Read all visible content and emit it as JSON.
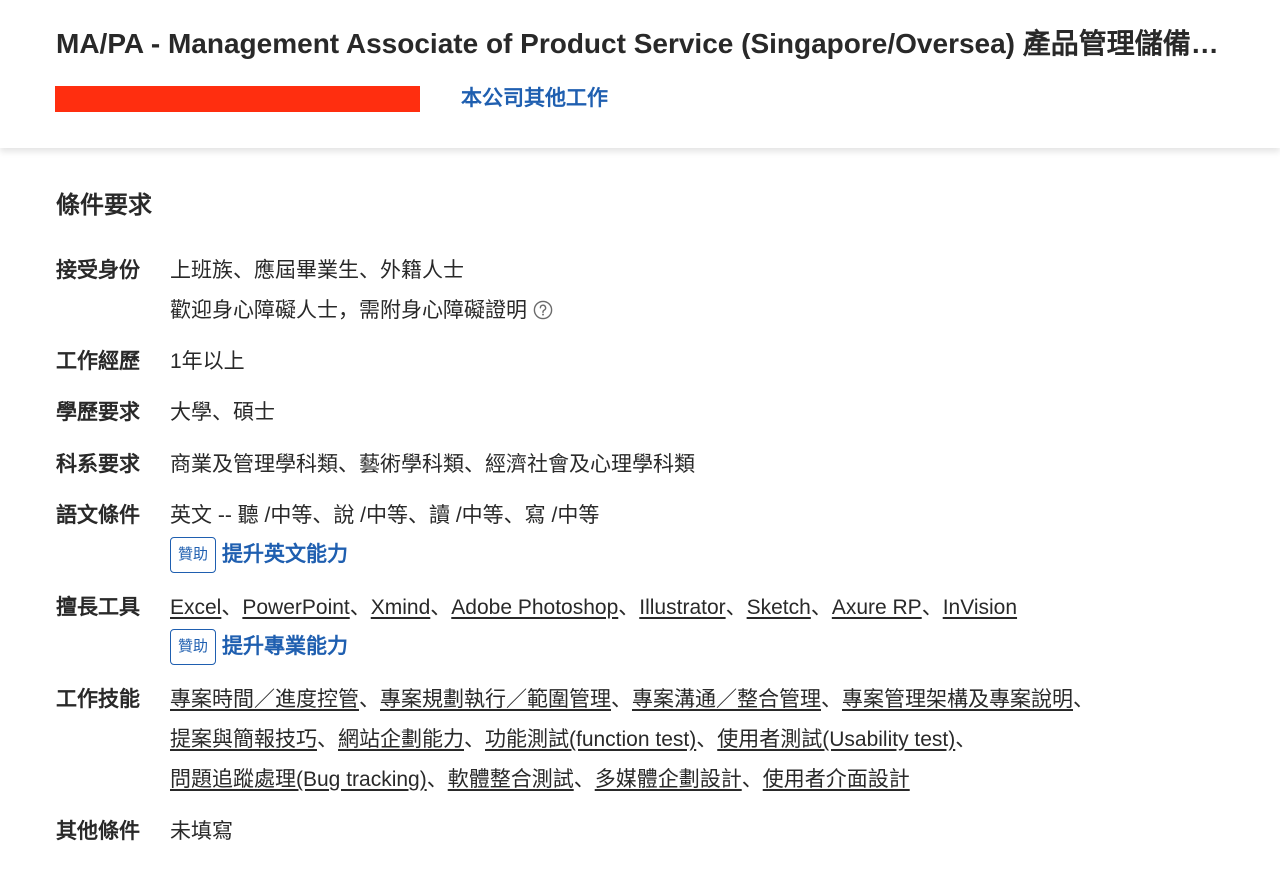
{
  "header": {
    "job_title": "MA/PA - Management Associate of Product Service (Singapore/Oversea) 產品管理儲備幹部",
    "redaction_color": "#ff2e0f",
    "company_jobs_link": "本公司其他工作"
  },
  "requirements": {
    "section_title": "條件要求",
    "identity": {
      "label": "接受身份",
      "value": "上班族、應屆畢業生、外籍人士",
      "note": "歡迎身心障礙人士，需附身心障礙證明"
    },
    "experience": {
      "label": "工作經歷",
      "value": "1年以上"
    },
    "education": {
      "label": "學歷要求",
      "value": "大學、碩士"
    },
    "major": {
      "label": "科系要求",
      "value": "商業及管理學科類、藝術學科類、經濟社會及心理學科類"
    },
    "language": {
      "label": "語文條件",
      "value": "英文 -- 聽 /中等、說 /中等、讀 /中等、寫 /中等",
      "sponsor_badge": "贊助",
      "promo_link": "提升英文能力"
    },
    "tools": {
      "label": "擅長工具",
      "items": [
        "Excel",
        "PowerPoint",
        "Xmind",
        "Adobe Photoshop",
        "Illustrator",
        "Sketch",
        "Axure RP",
        "InVision"
      ],
      "sponsor_badge": "贊助",
      "promo_link": "提升專業能力"
    },
    "skills": {
      "label": "工作技能",
      "items": [
        "專案時間／進度控管",
        "專案規劃執行／範圍管理",
        "專案溝通／整合管理",
        "專案管理架構及專案說明",
        "提案與簡報技巧",
        "網站企劃能力",
        "功能測試(function test)",
        "使用者測試(Usability test)",
        "問題追蹤處理(Bug tracking)",
        "軟體整合測試",
        "多媒體企劃設計",
        "使用者介面設計"
      ]
    },
    "other": {
      "label": "其他條件",
      "value": "未填寫"
    }
  },
  "separator": "、",
  "icons": {
    "help": "question-circle-icon"
  },
  "colors": {
    "link": "#1f5fb0",
    "text": "#292929"
  }
}
